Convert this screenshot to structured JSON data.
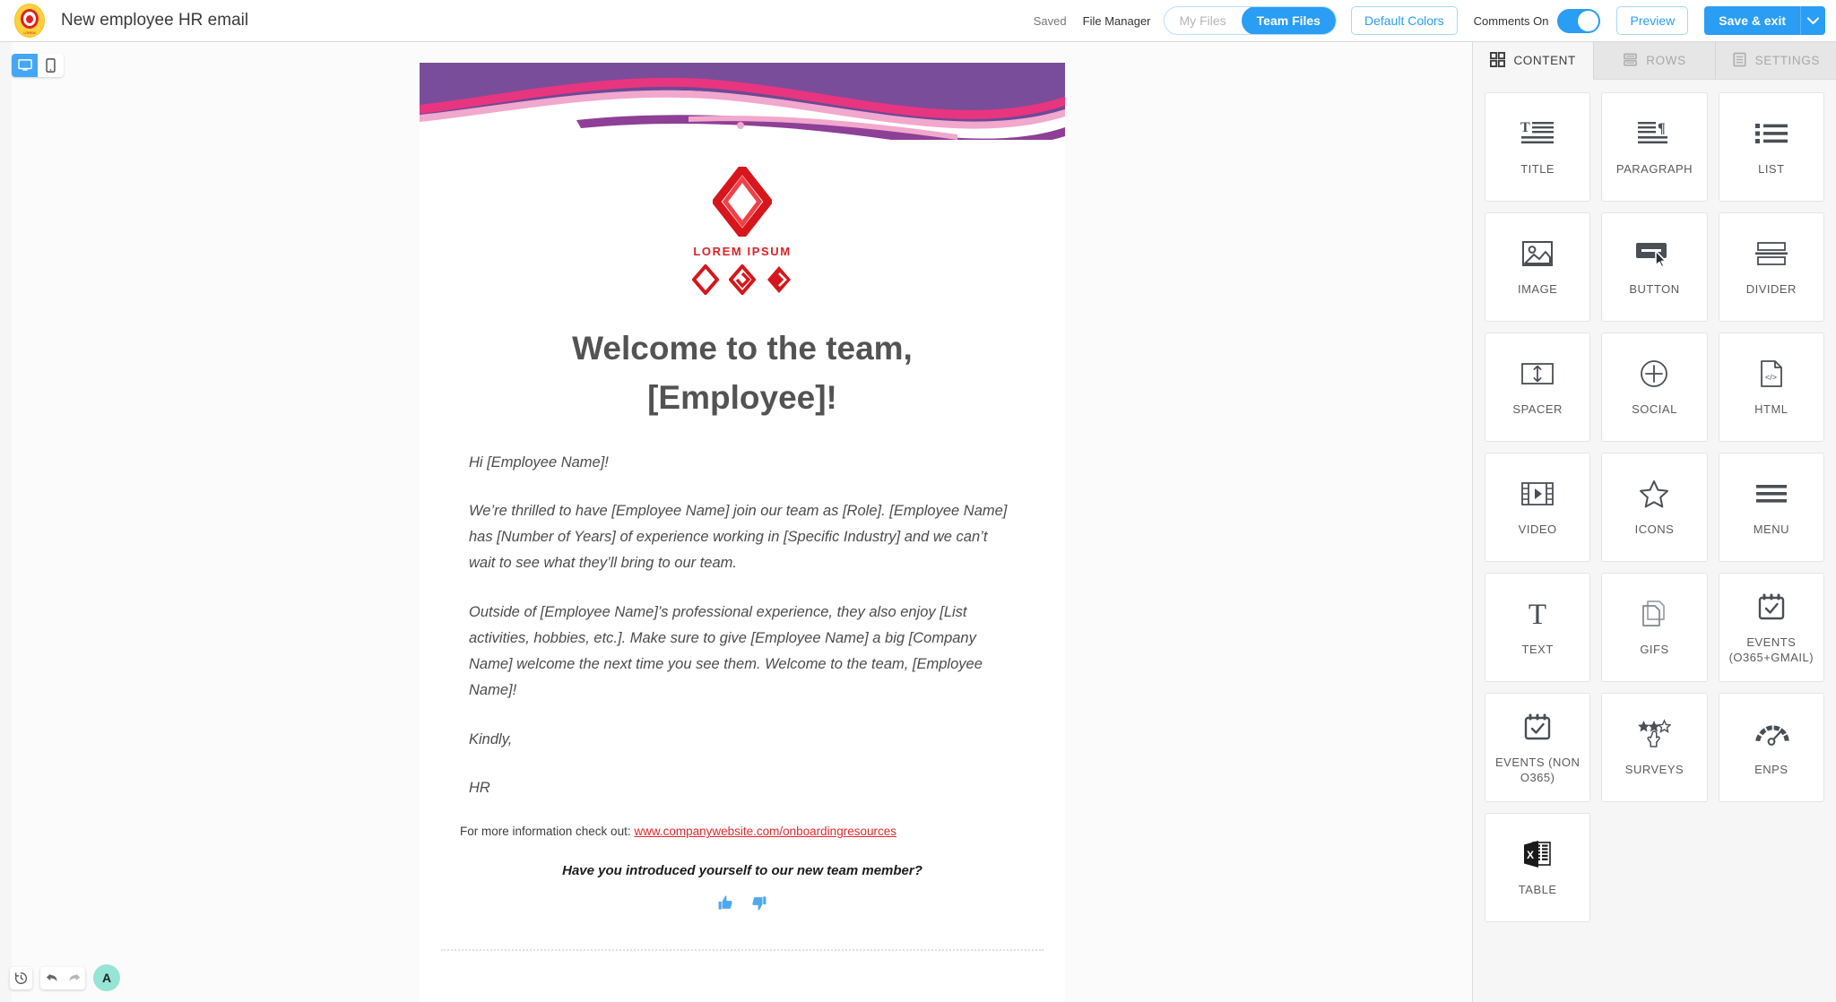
{
  "topbar": {
    "logo_icon": "company-logo-icon",
    "logo_caption": "LOREM",
    "doc_title": "New employee HR email",
    "saved_status": "Saved",
    "file_manager_label": "File Manager",
    "file_segment": {
      "options": [
        "My Files",
        "Team Files"
      ],
      "selected": "Team Files"
    },
    "default_colors_label": "Default Colors",
    "comments_label": "Comments On",
    "comments_toggle_on": true,
    "preview_label": "Preview",
    "save_exit_label": "Save & exit",
    "save_caret_icon": "chevron-down-icon",
    "accent_color": "#2a9df4"
  },
  "editor": {
    "device_toggle": {
      "desktop_icon": "desktop-icon",
      "mobile_icon": "mobile-icon",
      "selected": "desktop"
    },
    "bottom_controls": {
      "history_icon": "history-clock-icon",
      "undo_icon": "undo-arrow-icon",
      "redo_icon": "redo-arrow-icon",
      "avatar_initial": "A",
      "avatar_color": "#96e4d5"
    }
  },
  "email": {
    "banner_colors": {
      "purple": "#6b4a95",
      "magenta": "#e8357f",
      "violet": "#8e3f96",
      "pink": "#f2a7cd"
    },
    "logo": {
      "mark_icon": "diamond-logo-icon",
      "wordmark": "LOREM IPSUM",
      "small_marks": [
        "diamond-outline-icon",
        "diamond-swirl-icon",
        "diamond-solid-icon"
      ],
      "color": "#e01f26"
    },
    "title_line1": "Welcome to the team,",
    "title_line2": "[Employee]!",
    "paragraphs": [
      "Hi [Employee Name]!",
      "We’re thrilled to have [Employee Name] join our team as [Role]. [Employee Name] has [Number of Years] of experience working in [Specific Industry] and we can’t wait to see what they’ll bring to our team.",
      "Outside of [Employee Name]’s professional experience, they also enjoy [List activities, hobbies, etc.]. Make sure to give [Employee Name] a big [Company Name] welcome the next time you see them. Welcome to the team, [Employee Name]!",
      "Kindly,",
      "HR"
    ],
    "footer_note_prefix": "For more information check out: ",
    "footer_link": "www.companywebsite.com/onboardingresources",
    "question": "Have you introduced yourself to our new team member?",
    "thumbs_up_icon": "thumbs-up-icon",
    "thumbs_down_icon": "thumbs-down-icon",
    "thumbs_color": "#4fa8ef"
  },
  "sidebar": {
    "tabs": [
      {
        "label": "CONTENT",
        "icon": "grid-icon",
        "active": true
      },
      {
        "label": "ROWS",
        "icon": "rows-icon",
        "active": false
      },
      {
        "label": "SETTINGS",
        "icon": "settings-icon",
        "active": false
      }
    ],
    "tiles": [
      {
        "label": "TITLE",
        "icon": "title-icon"
      },
      {
        "label": "PARAGRAPH",
        "icon": "paragraph-icon"
      },
      {
        "label": "LIST",
        "icon": "list-icon"
      },
      {
        "label": "IMAGE",
        "icon": "image-icon"
      },
      {
        "label": "BUTTON",
        "icon": "button-icon"
      },
      {
        "label": "DIVIDER",
        "icon": "divider-icon"
      },
      {
        "label": "SPACER",
        "icon": "spacer-icon"
      },
      {
        "label": "SOCIAL",
        "icon": "social-plus-icon"
      },
      {
        "label": "HTML",
        "icon": "html-code-icon"
      },
      {
        "label": "VIDEO",
        "icon": "video-film-icon"
      },
      {
        "label": "ICONS",
        "icon": "star-icon"
      },
      {
        "label": "MENU",
        "icon": "hamburger-menu-icon"
      },
      {
        "label": "TEXT",
        "icon": "text-t-icon"
      },
      {
        "label": "GIFS",
        "icon": "gifs-pages-icon"
      },
      {
        "label": "EVENTS\n(O365+GMAIL)",
        "icon": "calendar-check-icon"
      },
      {
        "label": "EVENTS (NON O365)",
        "icon": "calendar-check-icon"
      },
      {
        "label": "SURVEYS",
        "icon": "star-rating-icon"
      },
      {
        "label": "ENPS",
        "icon": "gauge-icon"
      },
      {
        "label": "TABLE",
        "icon": "excel-table-icon"
      }
    ]
  }
}
